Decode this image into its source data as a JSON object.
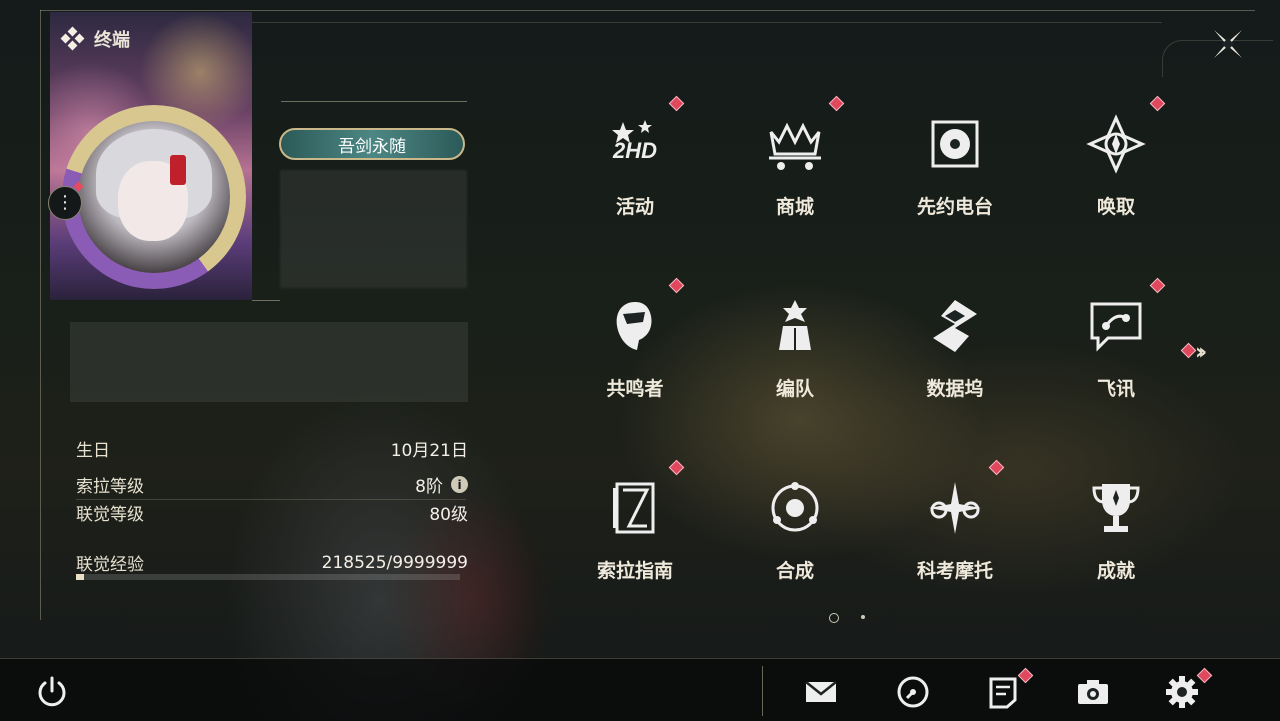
{
  "window": {
    "title": "终端"
  },
  "profile": {
    "title_badge": "吾剑永随",
    "more_label": "⋮",
    "stats": [
      {
        "label": "生日",
        "value": "10月21日"
      },
      {
        "label": "索拉等级",
        "value": "8阶"
      },
      {
        "label": "联觉等级",
        "value": "80级"
      }
    ],
    "exp": {
      "label": "联觉经验",
      "value": "218525/9999999",
      "progress": 0.022
    }
  },
  "menu": [
    {
      "label": "活动",
      "icon": "event-2hd-icon",
      "badge": true
    },
    {
      "label": "商城",
      "icon": "shop-crown-cart-icon",
      "badge": true
    },
    {
      "label": "先约电台",
      "icon": "radio-disc-icon",
      "badge": false
    },
    {
      "label": "唤取",
      "icon": "summon-compass-icon",
      "badge": true
    },
    {
      "label": "共鸣者",
      "icon": "resonator-head-icon",
      "badge": true
    },
    {
      "label": "编队",
      "icon": "team-chess-icon",
      "badge": false
    },
    {
      "label": "数据坞",
      "icon": "data-bank-icon",
      "badge": false
    },
    {
      "label": "飞讯",
      "icon": "message-bubble-icon",
      "badge": true
    },
    {
      "label": "索拉指南",
      "icon": "guide-book-icon",
      "badge": true
    },
    {
      "label": "合成",
      "icon": "synthesis-orbit-icon",
      "badge": false
    },
    {
      "label": "科考摩托",
      "icon": "motorbike-icon",
      "badge": true
    },
    {
      "label": "成就",
      "icon": "trophy-icon",
      "badge": false
    }
  ],
  "pager": {
    "pages": 2,
    "current": 1
  },
  "bottom_bar": [
    {
      "icon": "mail-icon",
      "badge": false
    },
    {
      "icon": "clock-icon",
      "badge": false
    },
    {
      "icon": "notice-icon",
      "badge": true
    },
    {
      "icon": "camera-icon",
      "badge": false
    },
    {
      "icon": "settings-gear-icon",
      "badge": true
    }
  ],
  "colors": {
    "accent_badge": "#e0485e",
    "panel_text": "#efe9dc",
    "title_badge_bg": "#3f7a77"
  }
}
